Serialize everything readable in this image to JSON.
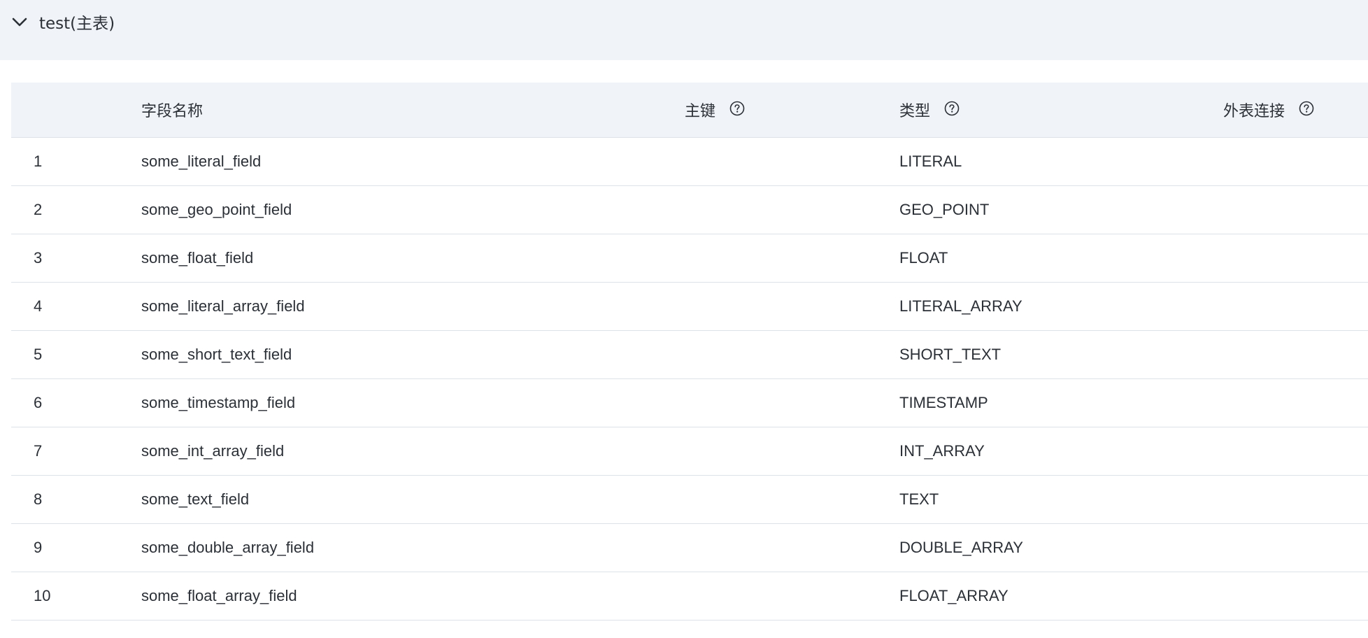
{
  "panel": {
    "title": "test(主表)"
  },
  "table": {
    "columns": [
      {
        "label": "",
        "help": false
      },
      {
        "label": "字段名称",
        "help": false
      },
      {
        "label": "主键",
        "help": true
      },
      {
        "label": "类型",
        "help": true
      },
      {
        "label": "外表连接",
        "help": true
      }
    ],
    "rows": [
      {
        "index": "1",
        "name": "some_literal_field",
        "primary_key": "",
        "type": "LITERAL",
        "foreign_link": ""
      },
      {
        "index": "2",
        "name": "some_geo_point_field",
        "primary_key": "",
        "type": "GEO_POINT",
        "foreign_link": ""
      },
      {
        "index": "3",
        "name": "some_float_field",
        "primary_key": "",
        "type": "FLOAT",
        "foreign_link": ""
      },
      {
        "index": "4",
        "name": "some_literal_array_field",
        "primary_key": "",
        "type": "LITERAL_ARRAY",
        "foreign_link": ""
      },
      {
        "index": "5",
        "name": "some_short_text_field",
        "primary_key": "",
        "type": "SHORT_TEXT",
        "foreign_link": ""
      },
      {
        "index": "6",
        "name": "some_timestamp_field",
        "primary_key": "",
        "type": "TIMESTAMP",
        "foreign_link": ""
      },
      {
        "index": "7",
        "name": "some_int_array_field",
        "primary_key": "",
        "type": "INT_ARRAY",
        "foreign_link": ""
      },
      {
        "index": "8",
        "name": "some_text_field",
        "primary_key": "",
        "type": "TEXT",
        "foreign_link": ""
      },
      {
        "index": "9",
        "name": "some_double_array_field",
        "primary_key": "",
        "type": "DOUBLE_ARRAY",
        "foreign_link": ""
      },
      {
        "index": "10",
        "name": "some_float_array_field",
        "primary_key": "",
        "type": "FLOAT_ARRAY",
        "foreign_link": ""
      }
    ]
  },
  "icons": {
    "collapse": "chevron-down-icon",
    "help": "question-circle-icon"
  },
  "colors": {
    "header_bg": "#f0f3f8",
    "text": "#2b2f36",
    "divider": "#dde1e8"
  }
}
